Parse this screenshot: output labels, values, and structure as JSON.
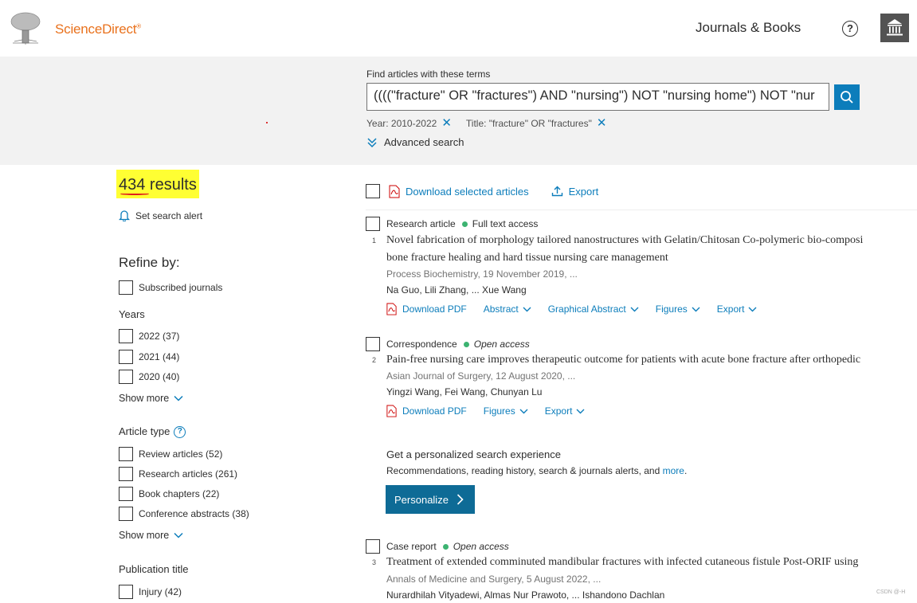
{
  "header": {
    "brand": "ScienceDirect",
    "brand_mark": "®",
    "journals_books": "Journals & Books",
    "help_glyph": "?"
  },
  "search": {
    "find_label": "Find articles with these terms",
    "query": "((((\"fracture\" OR \"fractures\") AND \"nursing\") NOT \"nursing home\") NOT \"nur",
    "filters": [
      {
        "label": "Year: 2010-2022"
      },
      {
        "label": "Title: \"fracture\" OR \"fractures\""
      }
    ],
    "advanced": "Advanced search"
  },
  "sidebar": {
    "results": "434 results",
    "set_alert": "Set search alert",
    "refine": "Refine by:",
    "subscribed": "Subscribed journals",
    "years_title": "Years",
    "years": [
      "2022 (37)",
      "2021 (44)",
      "2020 (40)"
    ],
    "show_more": "Show more",
    "article_type_title": "Article type",
    "article_types": [
      "Review articles (52)",
      "Research articles (261)",
      "Book chapters (22)",
      "Conference abstracts (38)"
    ],
    "publication_title": "Publication title",
    "publications": [
      "Injury (42)"
    ]
  },
  "toolbar": {
    "download_selected": "Download selected articles",
    "export": "Export"
  },
  "results": [
    {
      "type": "Research article",
      "access": "Full text access",
      "num": "1",
      "title_line1": "Novel fabrication of morphology tailored nanostructures with Gelatin/Chitosan Co-polymeric bio-composi",
      "title_line2": "bone fracture healing and hard tissue nursing care management",
      "source": "Process Biochemistry, 19 November 2019, ...",
      "authors": "Na Guo, Lili Zhang, ... Xue Wang",
      "actions": [
        "Download PDF",
        "Abstract",
        "Graphical Abstract",
        "Figures",
        "Export"
      ]
    },
    {
      "type": "Correspondence",
      "access": "Open access",
      "num": "2",
      "title_line1": "Pain-free nursing care improves therapeutic outcome for patients with acute bone fracture after orthopedic",
      "source": "Asian Journal of Surgery, 12 August 2020, ...",
      "authors": "Yingzi Wang, Fei Wang, Chunyan Lu",
      "actions": [
        "Download PDF",
        "Figures",
        "Export"
      ]
    },
    {
      "type": "Case report",
      "access": "Open access",
      "num": "3",
      "title_line1": "Treatment of extended comminuted mandibular fractures with infected cutaneous fistule Post-ORIF using",
      "source": "Annals of Medicine and Surgery, 5 August 2022, ...",
      "authors": "Nurardhilah Vityadewi, Almas Nur Prawoto, ... Ishandono Dachlan"
    }
  ],
  "promo": {
    "title": "Get a personalized search experience",
    "sub_text": "Recommendations, reading history, search & journals alerts, and ",
    "sub_link": "more",
    "sub_end": ".",
    "button": "Personalize"
  },
  "watermark": "CSDN @-H"
}
